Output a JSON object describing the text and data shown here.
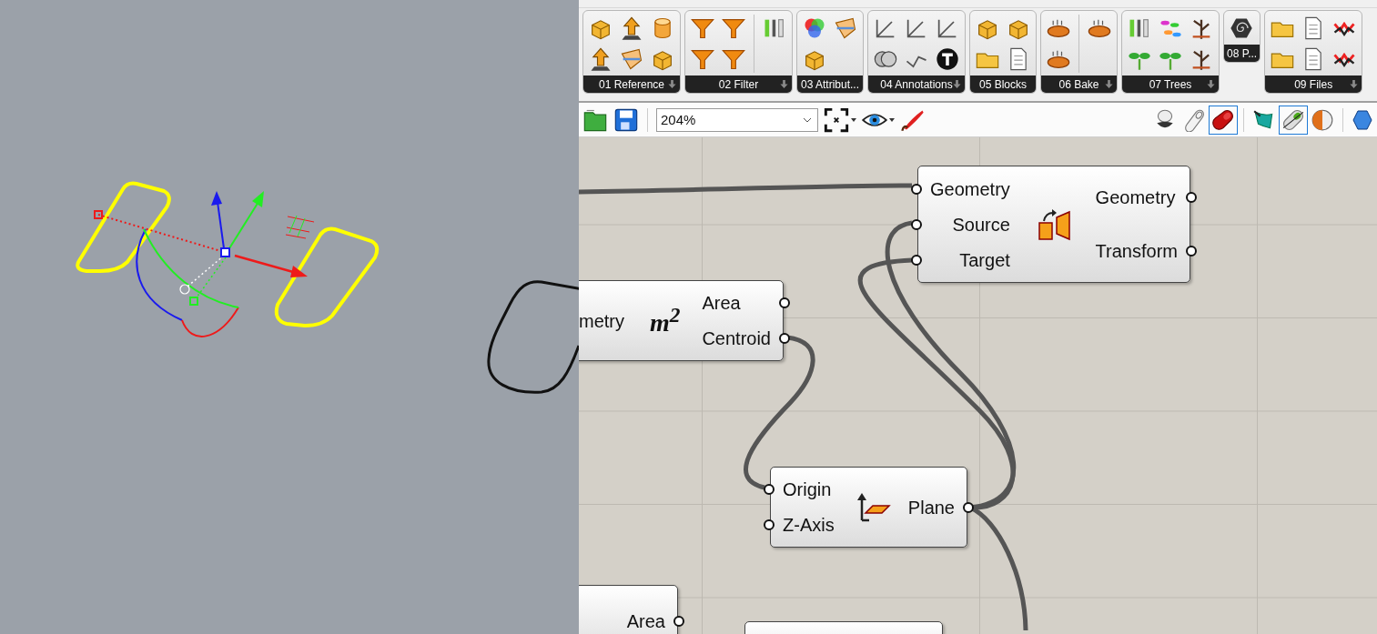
{
  "ribbon": {
    "groups": [
      {
        "label": "01 Reference",
        "has_menu": true
      },
      {
        "label": "02 Filter",
        "has_menu": true
      },
      {
        "label": "03 Attribut...",
        "has_menu": false
      },
      {
        "label": "04 Annotations",
        "has_menu": true
      },
      {
        "label": "05 Blocks",
        "has_menu": false
      },
      {
        "label": "06 Bake",
        "has_menu": true
      },
      {
        "label": "07 Trees",
        "has_menu": true
      },
      {
        "label": "08 P...",
        "has_menu": false
      },
      {
        "label": "09 Files",
        "has_menu": true
      }
    ]
  },
  "toolbar": {
    "zoom_value": "204%",
    "display_modes": [
      {
        "selected": false
      },
      {
        "selected": false
      },
      {
        "selected": true
      }
    ],
    "preview_modes": [
      {
        "selected": false
      },
      {
        "selected": true
      },
      {
        "selected": false
      }
    ]
  },
  "canvas": {
    "nodes": [
      {
        "kind": "transform",
        "inputs": [
          "Geometry",
          "Source",
          "Target"
        ],
        "outputs": [
          "Geometry",
          "Transform"
        ]
      },
      {
        "kind": "area",
        "icon_label": "m$^{2}$",
        "inputs": [
          "metry"
        ],
        "outputs": [
          "Area",
          "Centroid"
        ]
      },
      {
        "kind": "plane",
        "inputs": [
          "Origin",
          "Z-Axis"
        ],
        "outputs": [
          "Plane"
        ]
      },
      {
        "kind": "plain",
        "outputs": [
          "Area"
        ]
      },
      {
        "kind": "plain"
      }
    ]
  }
}
